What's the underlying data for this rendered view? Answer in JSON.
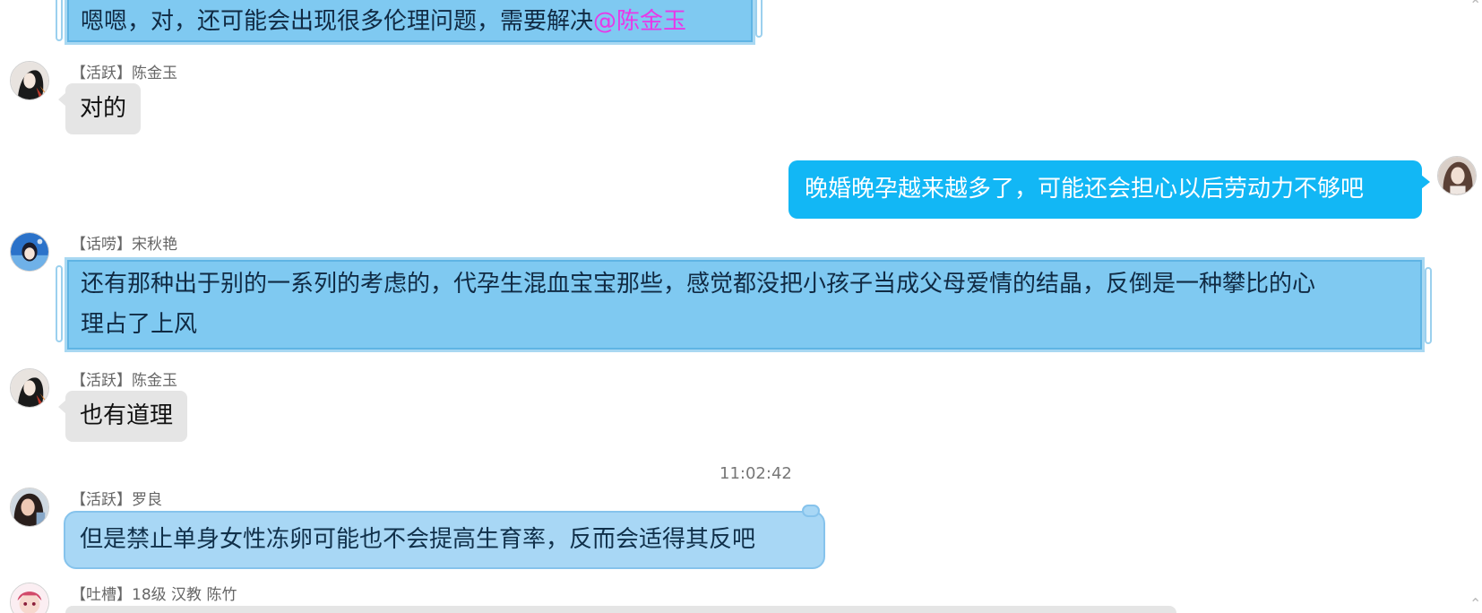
{
  "messages": [
    {
      "text": "嗯嗯，对，还可能会出现很多伦理问题，需要解决",
      "mention": "@陈金玉"
    },
    {
      "sender": "【活跃】陈金玉",
      "text": "对的"
    },
    {
      "text": "晚婚晚孕越来越多了，可能还会担心以后劳动力不够吧"
    },
    {
      "sender": "【话唠】宋秋艳",
      "text_line1": "还有那种出于别的一系列的考虑的，代孕生混血宝宝那些，感觉都没把小孩子当成父母爱情的结晶，反倒是一种攀比的心",
      "text_line2": "理占了上风"
    },
    {
      "sender": "【活跃】陈金玉",
      "text": "也有道理"
    },
    {
      "timestamp": "11:02:42"
    },
    {
      "sender": "【活跃】罗良",
      "text": "但是禁止单身女性冻卵可能也不会提高生育率，反而会适得其反吧"
    },
    {
      "sender": "【吐槽】18级 汉教 陈竹"
    }
  ],
  "colors": {
    "self_bubble": "#12b7f5",
    "gray_bubble": "#e5e5e5",
    "framed_bubble": "#7fc9f1",
    "cloud_bubble": "#a8d7f5",
    "mention": "#e838e8"
  }
}
